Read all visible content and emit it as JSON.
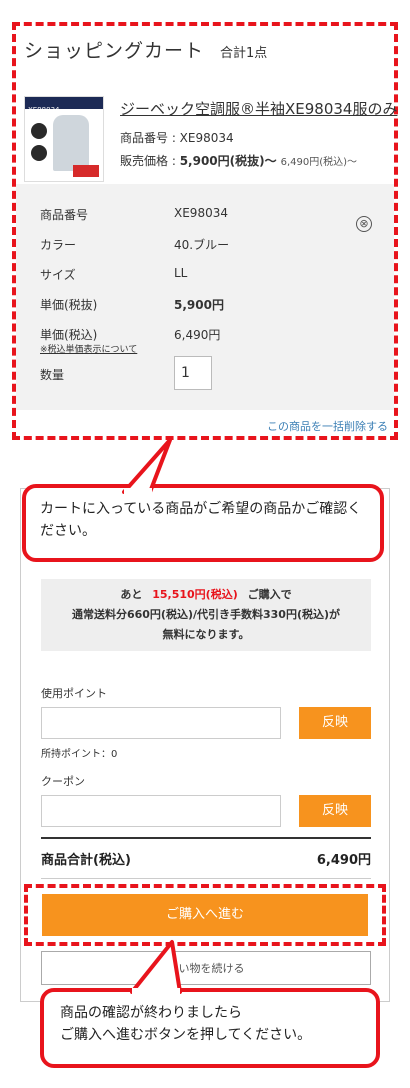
{
  "cart": {
    "title": "ショッピングカート",
    "count": "合計1点",
    "product": {
      "thumb_label": "XE98034",
      "name": "ジーベック空調服®半袖XE98034服のみ",
      "code_text": "商品番号 : XE98034",
      "price_label": "販売価格 : ",
      "price_ex_tax": "5,900円(税抜)〜",
      "price_in_tax": "6,490円(税込)〜"
    },
    "details": [
      {
        "label": "商品番号",
        "value": "XE98034"
      },
      {
        "label": "カラー",
        "value": "40.ブルー"
      },
      {
        "label": "サイズ",
        "value": "LL"
      },
      {
        "label": "単価(税抜)",
        "value": "5,900円"
      },
      {
        "label": "単価(税込)",
        "value": "6,490円"
      },
      {
        "label": "数量",
        "value": "1"
      }
    ],
    "tax_note": "※税込単価表示について",
    "remove_icon": "⊗",
    "remove_all": "この商品を一括削除する"
  },
  "callouts": {
    "first": "カートに入っている商品がご希望の商品かご確認ください。",
    "second_line1": "商品の確認が終わりましたら",
    "second_line2": "ご購入へ進むボタンを押してください。"
  },
  "summary": {
    "free_pre": "あと",
    "free_amount": "15,510円(税込)",
    "free_post": "ご購入で",
    "free_line2": "通常送料分660円(税込)/代引き手数料330円(税込)が",
    "free_line3": "無料になります。",
    "points_label": "使用ポイント",
    "apply_label": "反映",
    "points_owned": "所持ポイント：0",
    "coupon_label": "クーポン",
    "total_label": "商品合計(税込)",
    "total_value": "6,490円",
    "checkout_label": "ご購入へ進む",
    "continue_label": "買い物を続ける"
  },
  "colors": {
    "accent_red": "#e8141c",
    "button_orange": "#f7931e",
    "link_blue": "#3b7fb5"
  }
}
